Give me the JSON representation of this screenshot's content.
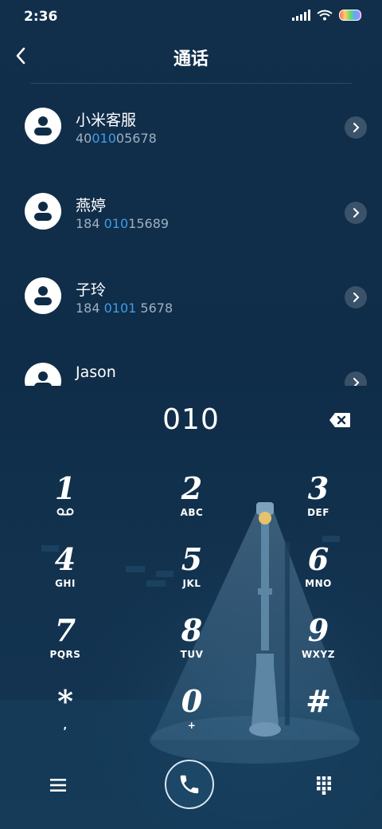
{
  "status_bar": {
    "time": "2:36"
  },
  "header": {
    "title": "通话"
  },
  "contacts": [
    {
      "name": "小米客服",
      "number_pre": "40",
      "number_match": "010",
      "number_post": "05678"
    },
    {
      "name": "燕婷",
      "number_pre": "184 ",
      "number_match": "010",
      "number_post": "15689"
    },
    {
      "name": "子玲",
      "number_pre": "184 ",
      "number_match": "0101",
      "number_post": " 5678"
    },
    {
      "name": "Jason",
      "number_pre": "",
      "number_match": "",
      "number_post": ""
    }
  ],
  "dial": {
    "number": "010"
  },
  "keypad": {
    "keys": [
      {
        "digit": "1",
        "letters": ""
      },
      {
        "digit": "2",
        "letters": "ABC"
      },
      {
        "digit": "3",
        "letters": "DEF"
      },
      {
        "digit": "4",
        "letters": "GHI"
      },
      {
        "digit": "5",
        "letters": "JKL"
      },
      {
        "digit": "6",
        "letters": "MNO"
      },
      {
        "digit": "7",
        "letters": "PQRS"
      },
      {
        "digit": "8",
        "letters": "TUV"
      },
      {
        "digit": "9",
        "letters": "WXYZ"
      },
      {
        "digit": "*",
        "letters": ","
      },
      {
        "digit": "0",
        "letters": "+"
      },
      {
        "digit": "#",
        "letters": ""
      }
    ]
  },
  "icons": {
    "back": "chevron-left-icon",
    "contact_chevron": "chevron-right-icon",
    "backspace": "backspace-icon",
    "voicemail": "voicemail-icon",
    "menu": "menu-icon",
    "call": "phone-icon",
    "keypad": "dialpad-icon"
  },
  "colors": {
    "background": "#0f2c47",
    "highlight": "#3f9bea",
    "secondary_text": "#9fb0c1"
  }
}
